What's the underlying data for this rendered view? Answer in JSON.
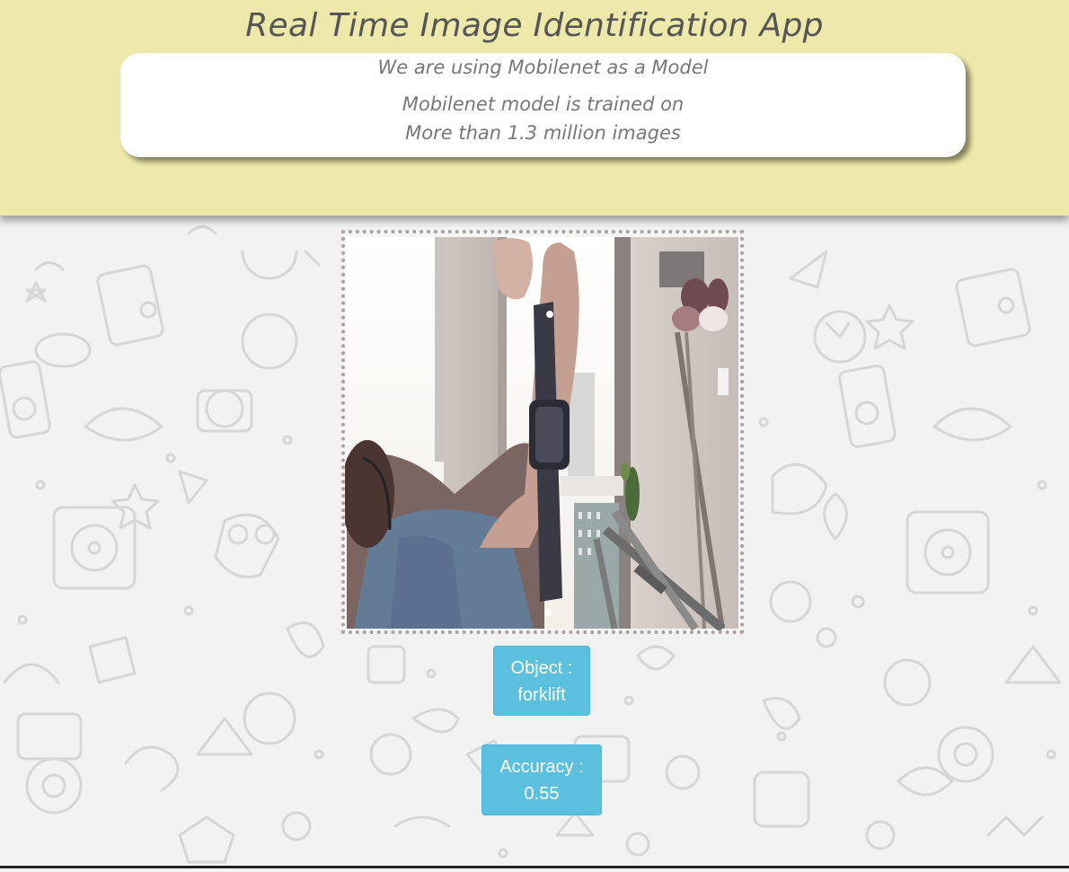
{
  "header": {
    "title": "Real Time Image Identification App",
    "info_line1": "We are using Mobilenet as a Model",
    "info_line2": "Mobilenet model is trained on",
    "info_line3": "More than 1.3 million images",
    "background_color": "#eee8aa"
  },
  "camera": {
    "icon": "webcam-feed",
    "frame_border_color": "#a9a0a0"
  },
  "results": {
    "object_label": "Object :",
    "object_value": "forklift",
    "accuracy_label": "Accuracy :",
    "accuracy_value": "0.55",
    "button_color": "#5bc0de"
  }
}
